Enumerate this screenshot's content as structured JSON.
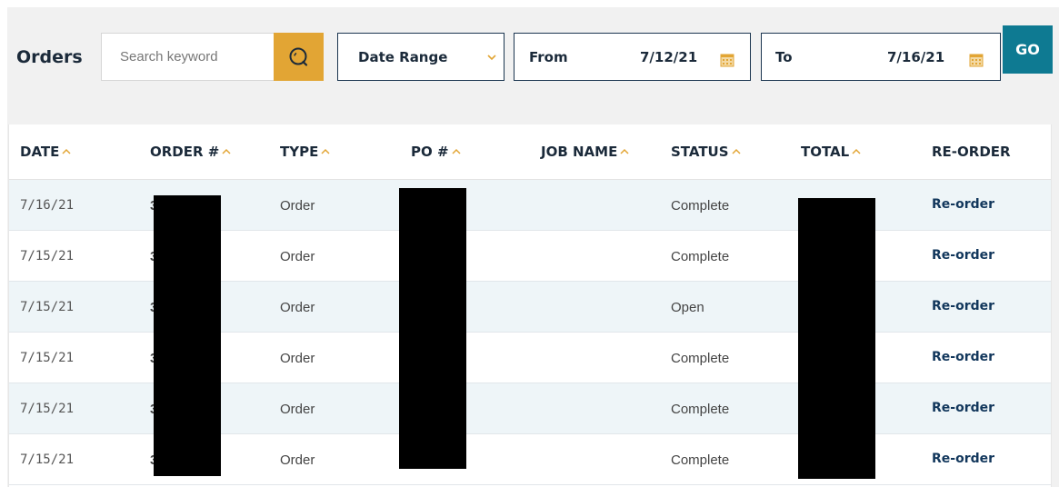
{
  "header": {
    "title": "Orders",
    "search": {
      "placeholder": "Search keyword",
      "value": ""
    },
    "date_range": {
      "label": "Date Range"
    },
    "from": {
      "label": "From",
      "value": "7/12/21"
    },
    "to": {
      "label": "To",
      "value": "7/16/21"
    },
    "go_label": "GO"
  },
  "colors": {
    "accent": "#e2a534",
    "go_button": "#0e7a92",
    "heading": "#1b2a3a",
    "link": "#12375c",
    "row_alt": "#eef5f8"
  },
  "table": {
    "columns": [
      {
        "key": "date",
        "label": "DATE",
        "sortable": true
      },
      {
        "key": "order",
        "label": "ORDER #",
        "sortable": true
      },
      {
        "key": "type",
        "label": "TYPE",
        "sortable": true
      },
      {
        "key": "po",
        "label": "PO #",
        "sortable": true
      },
      {
        "key": "job",
        "label": "JOB NAME",
        "sortable": true
      },
      {
        "key": "status",
        "label": "STATUS",
        "sortable": true
      },
      {
        "key": "total",
        "label": "TOTAL",
        "sortable": true
      },
      {
        "key": "reorder",
        "label": "RE-ORDER",
        "sortable": false
      }
    ],
    "rows": [
      {
        "date": "7/16/21",
        "order_visible": "3",
        "type": "Order",
        "status": "Complete",
        "reorder": "Re-order"
      },
      {
        "date": "7/15/21",
        "order_visible": "3",
        "type": "Order",
        "status": "Complete",
        "reorder": "Re-order"
      },
      {
        "date": "7/15/21",
        "order_visible": "3",
        "type": "Order",
        "status": "Open",
        "reorder": "Re-order"
      },
      {
        "date": "7/15/21",
        "order_visible": "3",
        "type": "Order",
        "status": "Complete",
        "reorder": "Re-order"
      },
      {
        "date": "7/15/21",
        "order_visible": "3",
        "type": "Order",
        "status": "Complete",
        "reorder": "Re-order"
      },
      {
        "date": "7/15/21",
        "order_visible": "3",
        "type": "Order",
        "status": "Complete",
        "reorder": "Re-order"
      }
    ]
  }
}
